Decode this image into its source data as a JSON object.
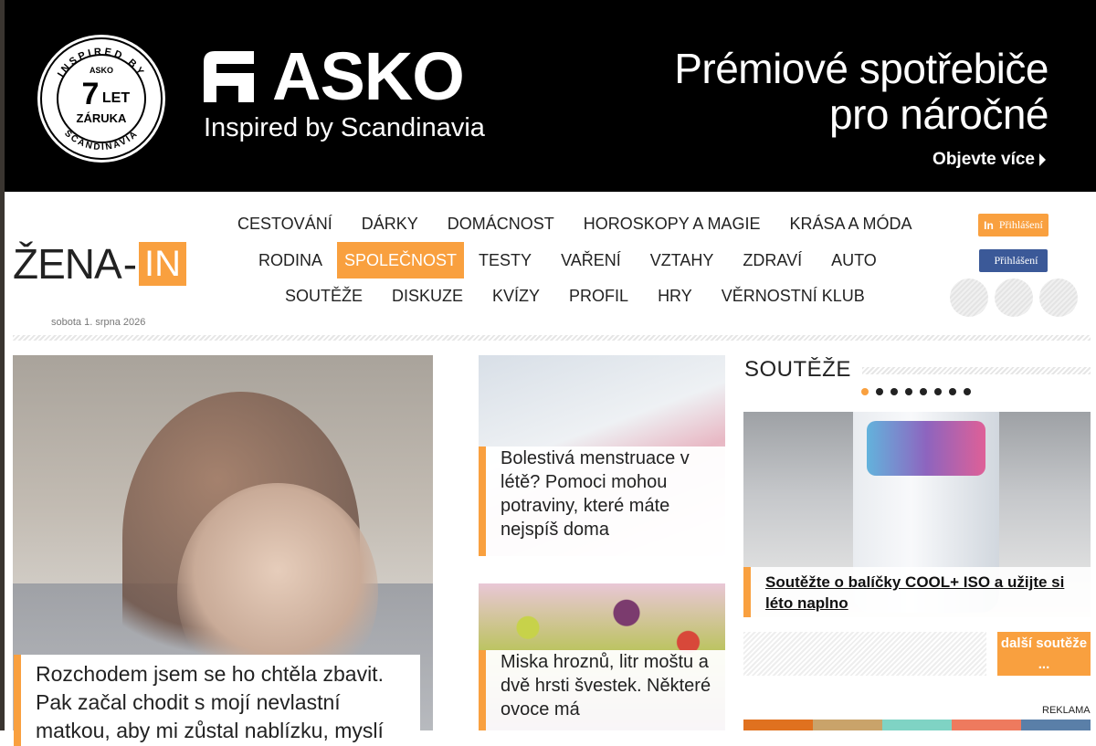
{
  "banner": {
    "seal": {
      "top_text": "INSPIRED BY",
      "brand": "ASKO",
      "number": "7",
      "unit": "LET",
      "label": "ZÁRUKA",
      "bottom_text": "SCANDINAVIA"
    },
    "brand": "ASKO",
    "tagline": "Inspired by Scandinavia",
    "headline_line1": "Prémiové spotřebiče",
    "headline_line2": "pro náročné",
    "cta": "Objevte více"
  },
  "site": {
    "logo_zena": "ŽENA",
    "logo_dash": "-",
    "logo_in": "IN",
    "date": "sobota 1. srpna 2026"
  },
  "nav": {
    "row1": [
      "CESTOVÁNÍ",
      "DÁRKY",
      "DOMÁCNOST",
      "HOROSKOPY A MAGIE",
      "KRÁSA A MÓDA"
    ],
    "row2": [
      "RODINA",
      "SPOLEČNOST",
      "TESTY",
      "VAŘENÍ",
      "VZTAHY",
      "ZDRAVÍ",
      "AUTO"
    ],
    "row3": [
      "SOUTĚŽE",
      "DISKUZE",
      "KVÍZY",
      "PROFIL",
      "HRY",
      "VĚRNOSTNÍ KLUB"
    ],
    "active": "SPOLEČNOST"
  },
  "login": {
    "linkedin_icon": "In",
    "linkedin_label": "Přihlášení",
    "facebook_icon": "",
    "facebook_label": "Přihlášení"
  },
  "articles": {
    "main_title": "Rozchodem jsem se ho chtěla zbavit. Pak začal chodit s mojí nevlastní matkou, aby mi zůstal nablízku, myslí",
    "art1_title": "Bolestivá menstruace v létě? Pomoci mohou potraviny, které máte nejspíš doma",
    "art2_title": "Miska hroznů, litr moštu a dvě hrsti švestek. Některé ovoce má"
  },
  "sidebar": {
    "title": "SOUTĚŽE",
    "dots_count": 8,
    "active_dot": 0,
    "card_title": "Soutěžte o balíčky COOL+ ISO a užijte si léto naplno",
    "more": "další soutěže ...",
    "reklama": "REKLAMA",
    "color_bar": [
      "#e0711f",
      "#c9a36a",
      "#7fd3c4",
      "#ee7a5e",
      "#5a7fa8"
    ]
  },
  "colors": {
    "accent": "#f9a03f",
    "banner_bg": "#000000",
    "facebook": "#3b5998"
  }
}
